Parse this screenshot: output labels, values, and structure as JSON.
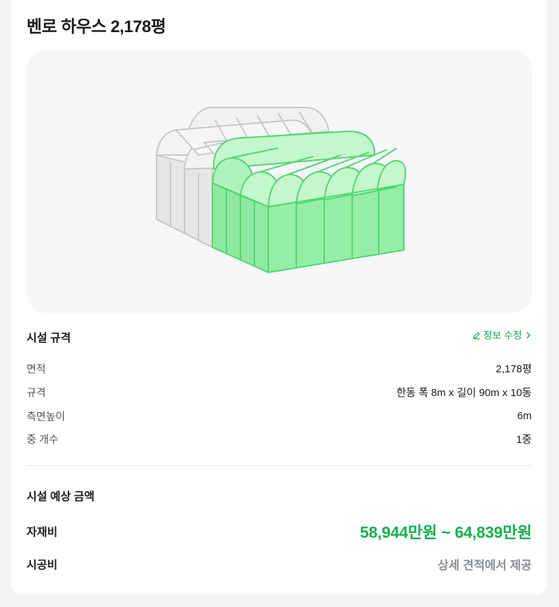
{
  "header": {
    "title": "벤로 하우스 2,178평"
  },
  "spec": {
    "heading": "시설 규격",
    "edit_label": "정보 수정",
    "rows": [
      {
        "label": "면적",
        "value": "2,178평"
      },
      {
        "label": "규격",
        "value": "한동 폭 8m x 길이 90m x 10동"
      },
      {
        "label": "측면높이",
        "value": "6m"
      },
      {
        "label": "중 개수",
        "value": "1중"
      }
    ]
  },
  "price": {
    "heading": "시설 예상 금액",
    "material_label": "자재비",
    "material_value": "58,944만원 ~ 64,839만원",
    "construction_label": "시공비",
    "construction_value": "상세 견적에서 제공"
  },
  "colors": {
    "accent": "#17b04f",
    "greenhouse_fill": "#95eea6",
    "greenhouse_roof": "#c4f7cc",
    "greenhouse_stroke": "#52d672",
    "ghost_fill": "#ededed",
    "ghost_stroke": "#c8c8c8"
  },
  "icons": {
    "edit": "pencil-icon",
    "chevron": "chevron-right-icon"
  }
}
